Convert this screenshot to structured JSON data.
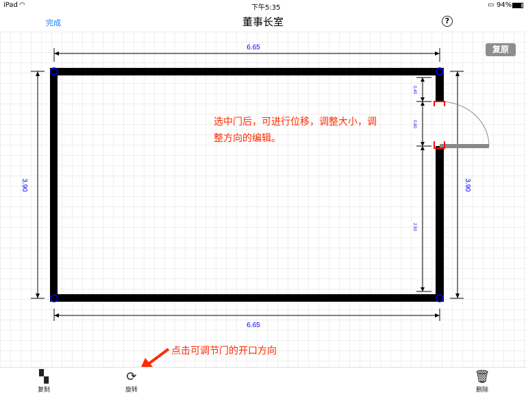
{
  "status": {
    "device": "iPad",
    "time": "下午5:35",
    "battery": "94%"
  },
  "nav": {
    "done": "完成",
    "title": "董事长室",
    "help": "?"
  },
  "reset": "复原",
  "dimensions": {
    "top": "6.65",
    "bottom": "6.65",
    "left": "3.90",
    "right": "3.90",
    "seg1": "0.40",
    "seg2": "0.80",
    "seg3": "2.50"
  },
  "annotations": {
    "door_edit_line1": "选中门后，可进行位移，调整大小，调",
    "door_edit_line2": "整方向的编辑。",
    "rotate_hint": "点击可调节门的开口方向"
  },
  "colors": {
    "wall": "#000000",
    "corner": "#0000ff",
    "door_mark": "#ff0000",
    "annotation": "#ff2a00",
    "dim_text": "#0000ff"
  },
  "toolbar": {
    "copy": "复制",
    "rotate": "旋转",
    "delete": "删除"
  }
}
